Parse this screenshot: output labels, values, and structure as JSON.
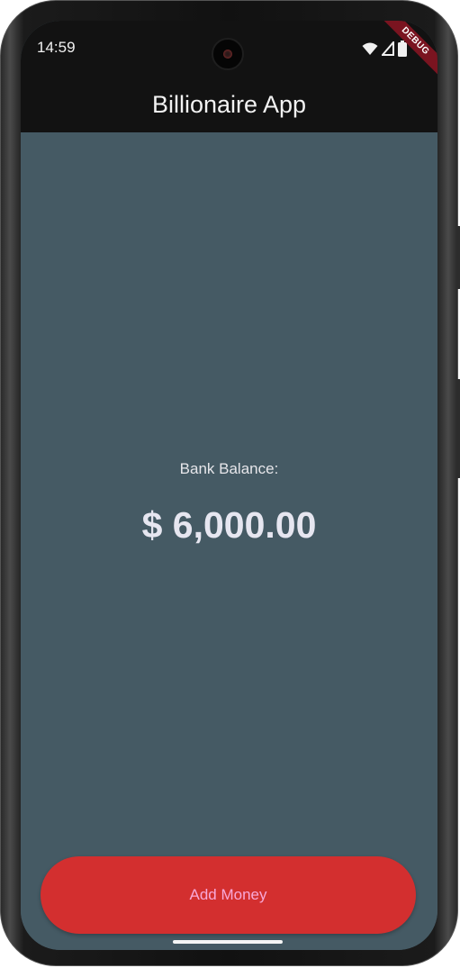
{
  "status_bar": {
    "time": "14:59",
    "icons": [
      "wifi-icon",
      "cellular-signal-icon",
      "battery-icon"
    ],
    "debug_banner": "DEBUG"
  },
  "app_bar": {
    "title": "Billionaire App"
  },
  "balance": {
    "label": "Bank Balance:",
    "value": "$ 6,000.00"
  },
  "actions": {
    "add_money_label": "Add Money"
  },
  "colors": {
    "app_bar_bg": "#121212",
    "body_bg": "#455a64",
    "button_bg": "#d32f2f",
    "button_text": "#f8a8d8"
  }
}
